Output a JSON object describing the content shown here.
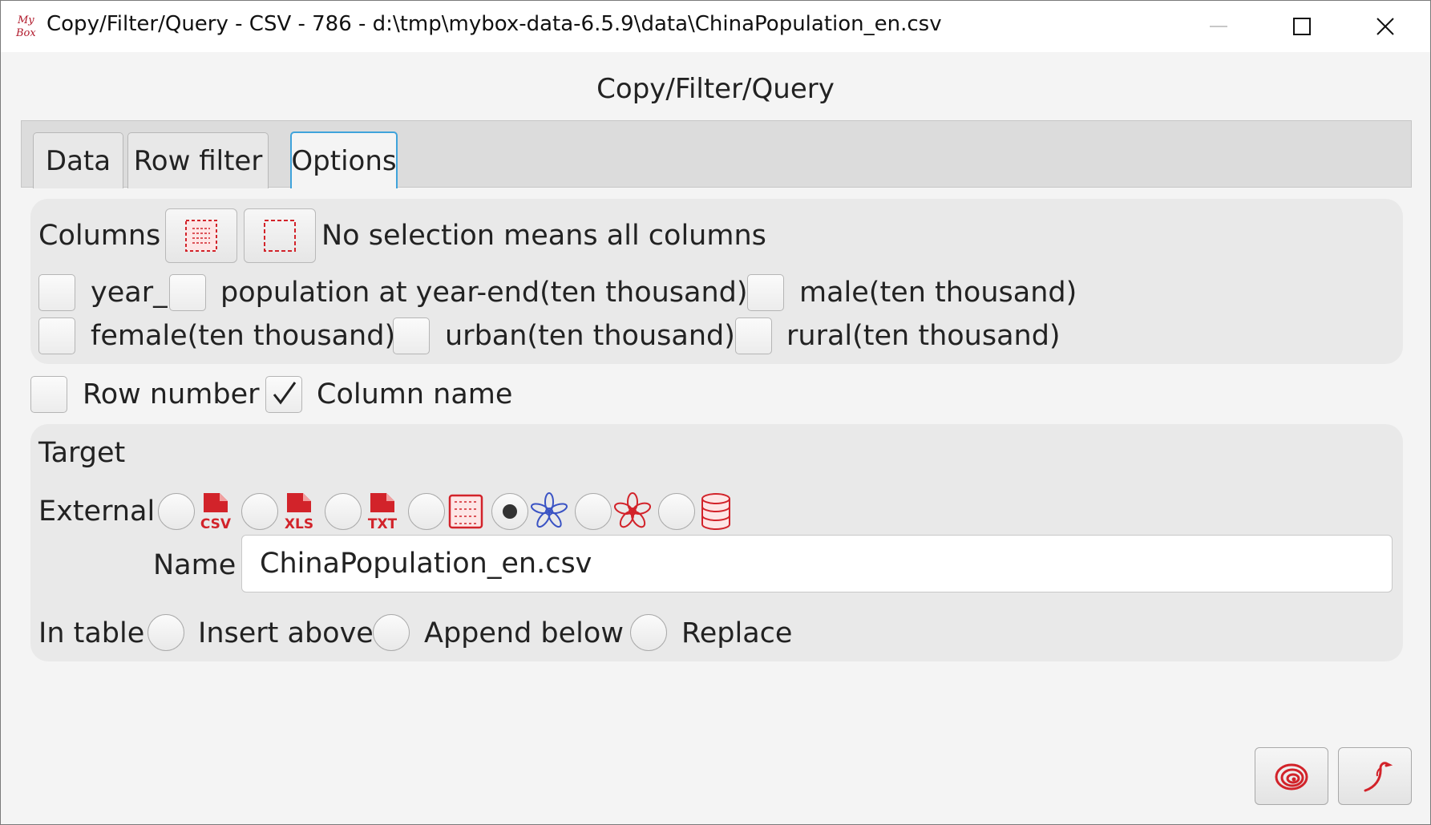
{
  "window": {
    "title": "Copy/Filter/Query - CSV - 786 - d:\\tmp\\mybox-data-6.5.9\\data\\ChinaPopulation_en.csv",
    "logo_text": [
      "My",
      "Box"
    ]
  },
  "heading": "Copy/Filter/Query",
  "tabs": [
    {
      "label": "Data",
      "selected": false
    },
    {
      "label": "Row filter",
      "selected": false
    },
    {
      "label": "Options",
      "selected": true
    }
  ],
  "columns": {
    "label": "Columns",
    "hint": "No selection means all columns",
    "select_all_icon": "select-all-icon",
    "select_none_icon": "select-none-icon",
    "items": [
      {
        "label": "year_",
        "checked": false
      },
      {
        "label": "population at year-end(ten thousand)",
        "checked": false
      },
      {
        "label": "male(ten thousand)",
        "checked": false
      },
      {
        "label": "female(ten thousand)",
        "checked": false
      },
      {
        "label": "urban(ten thousand)",
        "checked": false
      },
      {
        "label": "rural(ten thousand)",
        "checked": false
      }
    ]
  },
  "options": {
    "row_number": {
      "label": "Row number",
      "checked": false
    },
    "column_name": {
      "label": "Column name",
      "checked": true
    }
  },
  "target": {
    "heading": "Target",
    "external_label": "External",
    "formats": [
      {
        "icon": "csv-file-icon",
        "text": "CSV",
        "selected": false
      },
      {
        "icon": "xls-file-icon",
        "text": "XLS",
        "selected": false
      },
      {
        "icon": "txt-file-icon",
        "text": "TXT",
        "selected": false
      },
      {
        "icon": "matrix-icon",
        "selected": false
      },
      {
        "icon": "blue-flower-icon",
        "selected": true
      },
      {
        "icon": "red-flower-icon",
        "selected": false
      },
      {
        "icon": "database-icon",
        "selected": false
      }
    ],
    "name_label": "Name",
    "name_value": "ChinaPopulation_en.csv",
    "in_table_label": "In table",
    "in_table_options": [
      {
        "label": "Insert above",
        "selected": false
      },
      {
        "label": "Append below",
        "selected": false
      },
      {
        "label": "Replace",
        "selected": false
      }
    ]
  },
  "buttons": {
    "ok_icon": "spiral-icon",
    "cancel_icon": "bird-icon"
  },
  "colors": {
    "accent_red": "#d2232a",
    "accent_blue": "#3a53c4",
    "tab_focus": "#3fa3db"
  }
}
